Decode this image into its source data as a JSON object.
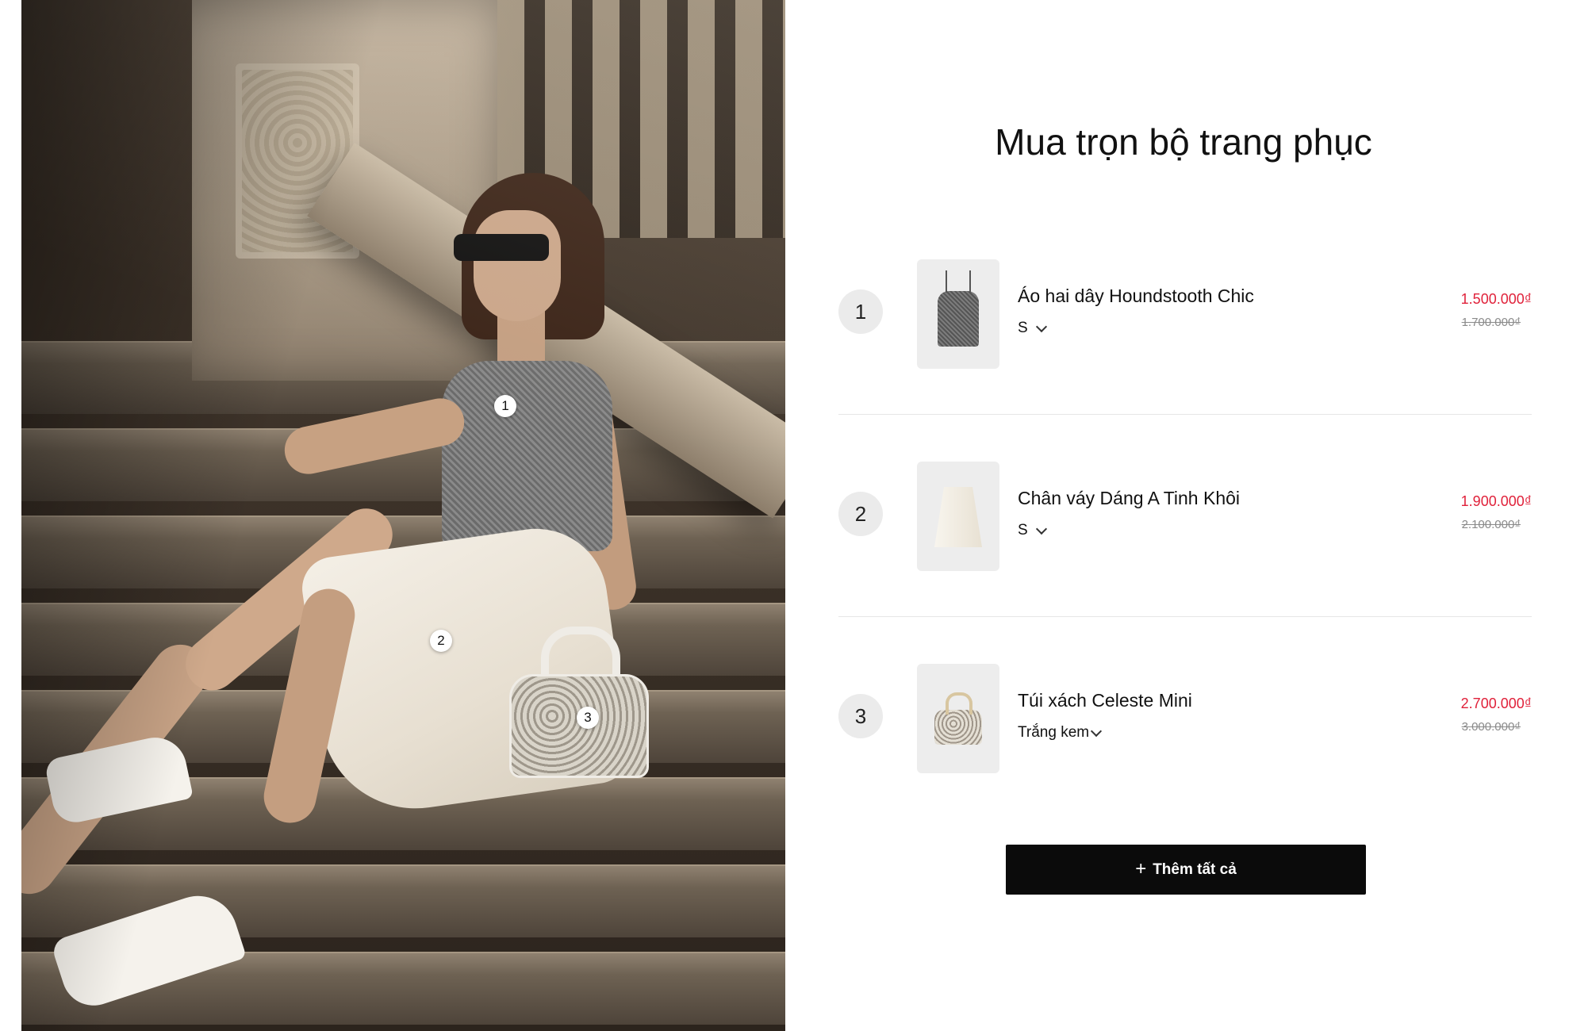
{
  "title": "Mua trọn bộ trang phục",
  "hotspots": [
    "1",
    "2",
    "3"
  ],
  "items": [
    {
      "number": "1",
      "name": "Áo hai dây Houndstooth Chic",
      "variant": "S",
      "price_sale": "1.500.000₫",
      "price_original": "1.700.000₫",
      "thumb_icon": "camisole-top-image"
    },
    {
      "number": "2",
      "name": "Chân váy Dáng A Tinh Khôi",
      "variant": "S",
      "price_sale": "1.900.000₫",
      "price_original": "2.100.000₫",
      "thumb_icon": "a-line-skirt-image"
    },
    {
      "number": "3",
      "name": "Túi xách Celeste Mini",
      "variant": "Trắng kem",
      "price_sale": "2.700.000₫",
      "price_original": "3.000.000₫",
      "thumb_icon": "handbag-image"
    }
  ],
  "add_all": {
    "icon": "plus-icon",
    "label": "Thêm tất cả"
  },
  "colors": {
    "sale_price": "#e0213a",
    "button_bg": "#0b0b0b",
    "badge_bg": "#ebebeb"
  }
}
